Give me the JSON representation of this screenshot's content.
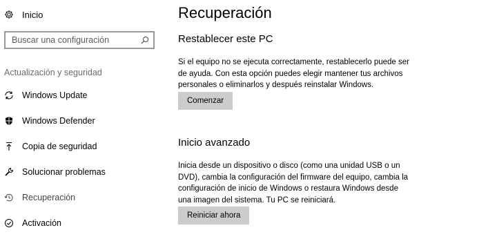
{
  "sidebar": {
    "home_label": "Inicio",
    "search": {
      "placeholder": "Buscar una configuración"
    },
    "section_heading": "Actualización y seguridad",
    "items": [
      {
        "label": "Windows Update",
        "icon": "refresh-icon"
      },
      {
        "label": "Windows Defender",
        "icon": "shield-icon"
      },
      {
        "label": "Copia de seguridad",
        "icon": "upload-arrow-icon"
      },
      {
        "label": "Solucionar problemas",
        "icon": "wrench-icon"
      },
      {
        "label": "Recuperación",
        "icon": "history-icon",
        "active": true
      },
      {
        "label": "Activación",
        "icon": "check-circle-icon"
      }
    ]
  },
  "main": {
    "title": "Recuperación",
    "reset": {
      "heading": "Restablecer este PC",
      "description": "Si el equipo no se ejecuta correctamente, restablecerlo puede ser de ayuda. Con esta opción puedes elegir mantener tus archivos personales o eliminarlos y después reinstalar Windows.",
      "button_label": "Comenzar"
    },
    "advanced": {
      "heading": "Inicio avanzado",
      "description": "Inicia desde un dispositivo o disco (como una unidad USB o un DVD), cambia la configuración del firmware del equipo, cambia la configuración de inicio de Windows o restaura Windows desde una imagen del sistema. Tu PC se reiniciará.",
      "button_label": "Reiniciar ahora"
    }
  },
  "colors": {
    "button_bg": "#cccccc",
    "search_border": "#999999",
    "muted_text": "#6b6b6b"
  }
}
